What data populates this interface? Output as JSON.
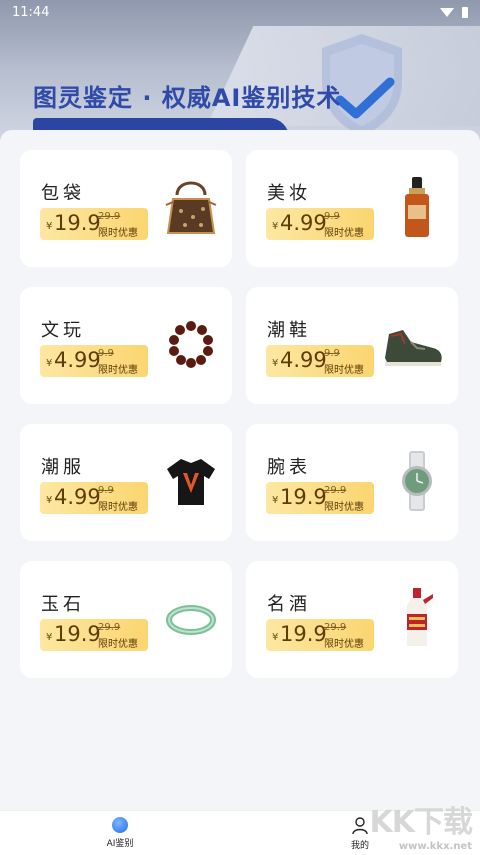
{
  "status_bar": {
    "time": "11:44"
  },
  "banner": {
    "title": "图灵鉴定 · 权威AI鉴别技术"
  },
  "categories": [
    {
      "title": "包袋",
      "price": "19.9",
      "old_price": "29.9",
      "promo": "限时优惠",
      "image": "handbag-icon"
    },
    {
      "title": "美妆",
      "price": "4.99",
      "old_price": "9.9",
      "promo": "限时优惠",
      "image": "cosmetic-bottle-icon"
    },
    {
      "title": "文玩",
      "price": "4.99",
      "old_price": "9.9",
      "promo": "限时优惠",
      "image": "bead-bracelet-icon"
    },
    {
      "title": "潮鞋",
      "price": "4.99",
      "old_price": "9.9",
      "promo": "限时优惠",
      "image": "sneaker-icon"
    },
    {
      "title": "潮服",
      "price": "4.99",
      "old_price": "9.9",
      "promo": "限时优惠",
      "image": "tshirt-icon"
    },
    {
      "title": "腕表",
      "price": "19.9",
      "old_price": "29.9",
      "promo": "限时优惠",
      "image": "wristwatch-icon"
    },
    {
      "title": "玉石",
      "price": "19.9",
      "old_price": "29.9",
      "promo": "限时优惠",
      "image": "jade-bangle-icon"
    },
    {
      "title": "名酒",
      "price": "19.9",
      "old_price": "29.9",
      "promo": "限时优惠",
      "image": "liquor-bottle-icon"
    }
  ],
  "currency_symbol": "¥",
  "tabs": [
    {
      "label": "AI鉴别",
      "icon": "ai-appraisal-icon",
      "active": true
    },
    {
      "label": "我的",
      "icon": "user-icon",
      "active": false
    }
  ],
  "watermark": {
    "logo": "KK下载",
    "url": "www.kkx.net"
  },
  "colors": {
    "accent": "#2f4aa8",
    "price_tag": "#fbd570",
    "active_tab": "#1f6fe8"
  }
}
